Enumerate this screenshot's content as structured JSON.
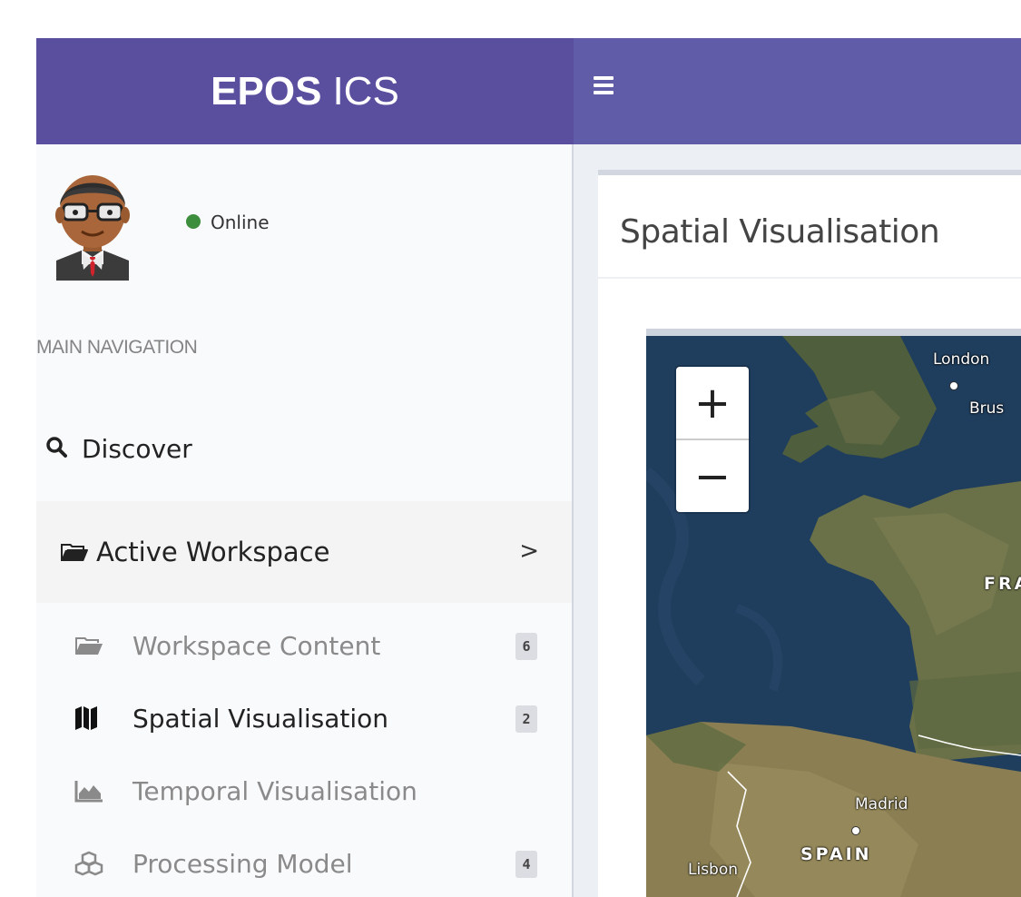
{
  "header": {
    "brand_strong": "EPOS",
    "brand_light": "ICS",
    "menu_icon": "hamburger-icon"
  },
  "user": {
    "status": "Online",
    "status_color": "#3c8d3c",
    "avatar_icon": "user-avatar"
  },
  "sidebar": {
    "section_header": "MAIN NAVIGATION",
    "discover": {
      "label": "Discover",
      "icon": "search-icon"
    },
    "active_workspace": {
      "label": "Active Workspace",
      "icon": "folder-open-icon",
      "chevron": ">"
    },
    "items": [
      {
        "label": "Workspace Content",
        "icon": "folder-open-icon",
        "badge": "6"
      },
      {
        "label": "Spatial Visualisation",
        "icon": "map-icon",
        "badge": "2"
      },
      {
        "label": "Temporal Visualisation",
        "icon": "area-chart-icon",
        "badge": ""
      },
      {
        "label": "Processing Model",
        "icon": "cubes-icon",
        "badge": "4"
      }
    ]
  },
  "content": {
    "title": "Spatial Visualisation",
    "map": {
      "zoom_in": "+",
      "zoom_out": "−",
      "labels": {
        "london": "London",
        "brussels": "Brus",
        "france": "FRA",
        "madrid": "Madrid",
        "spain": "SPAIN",
        "lisbon": "Lisbon"
      }
    }
  },
  "colors": {
    "brand": "#5a4e9e",
    "topbar": "#605ca8",
    "sidebar_bg": "#f9fafc",
    "content_bg": "#ecf0f5"
  }
}
